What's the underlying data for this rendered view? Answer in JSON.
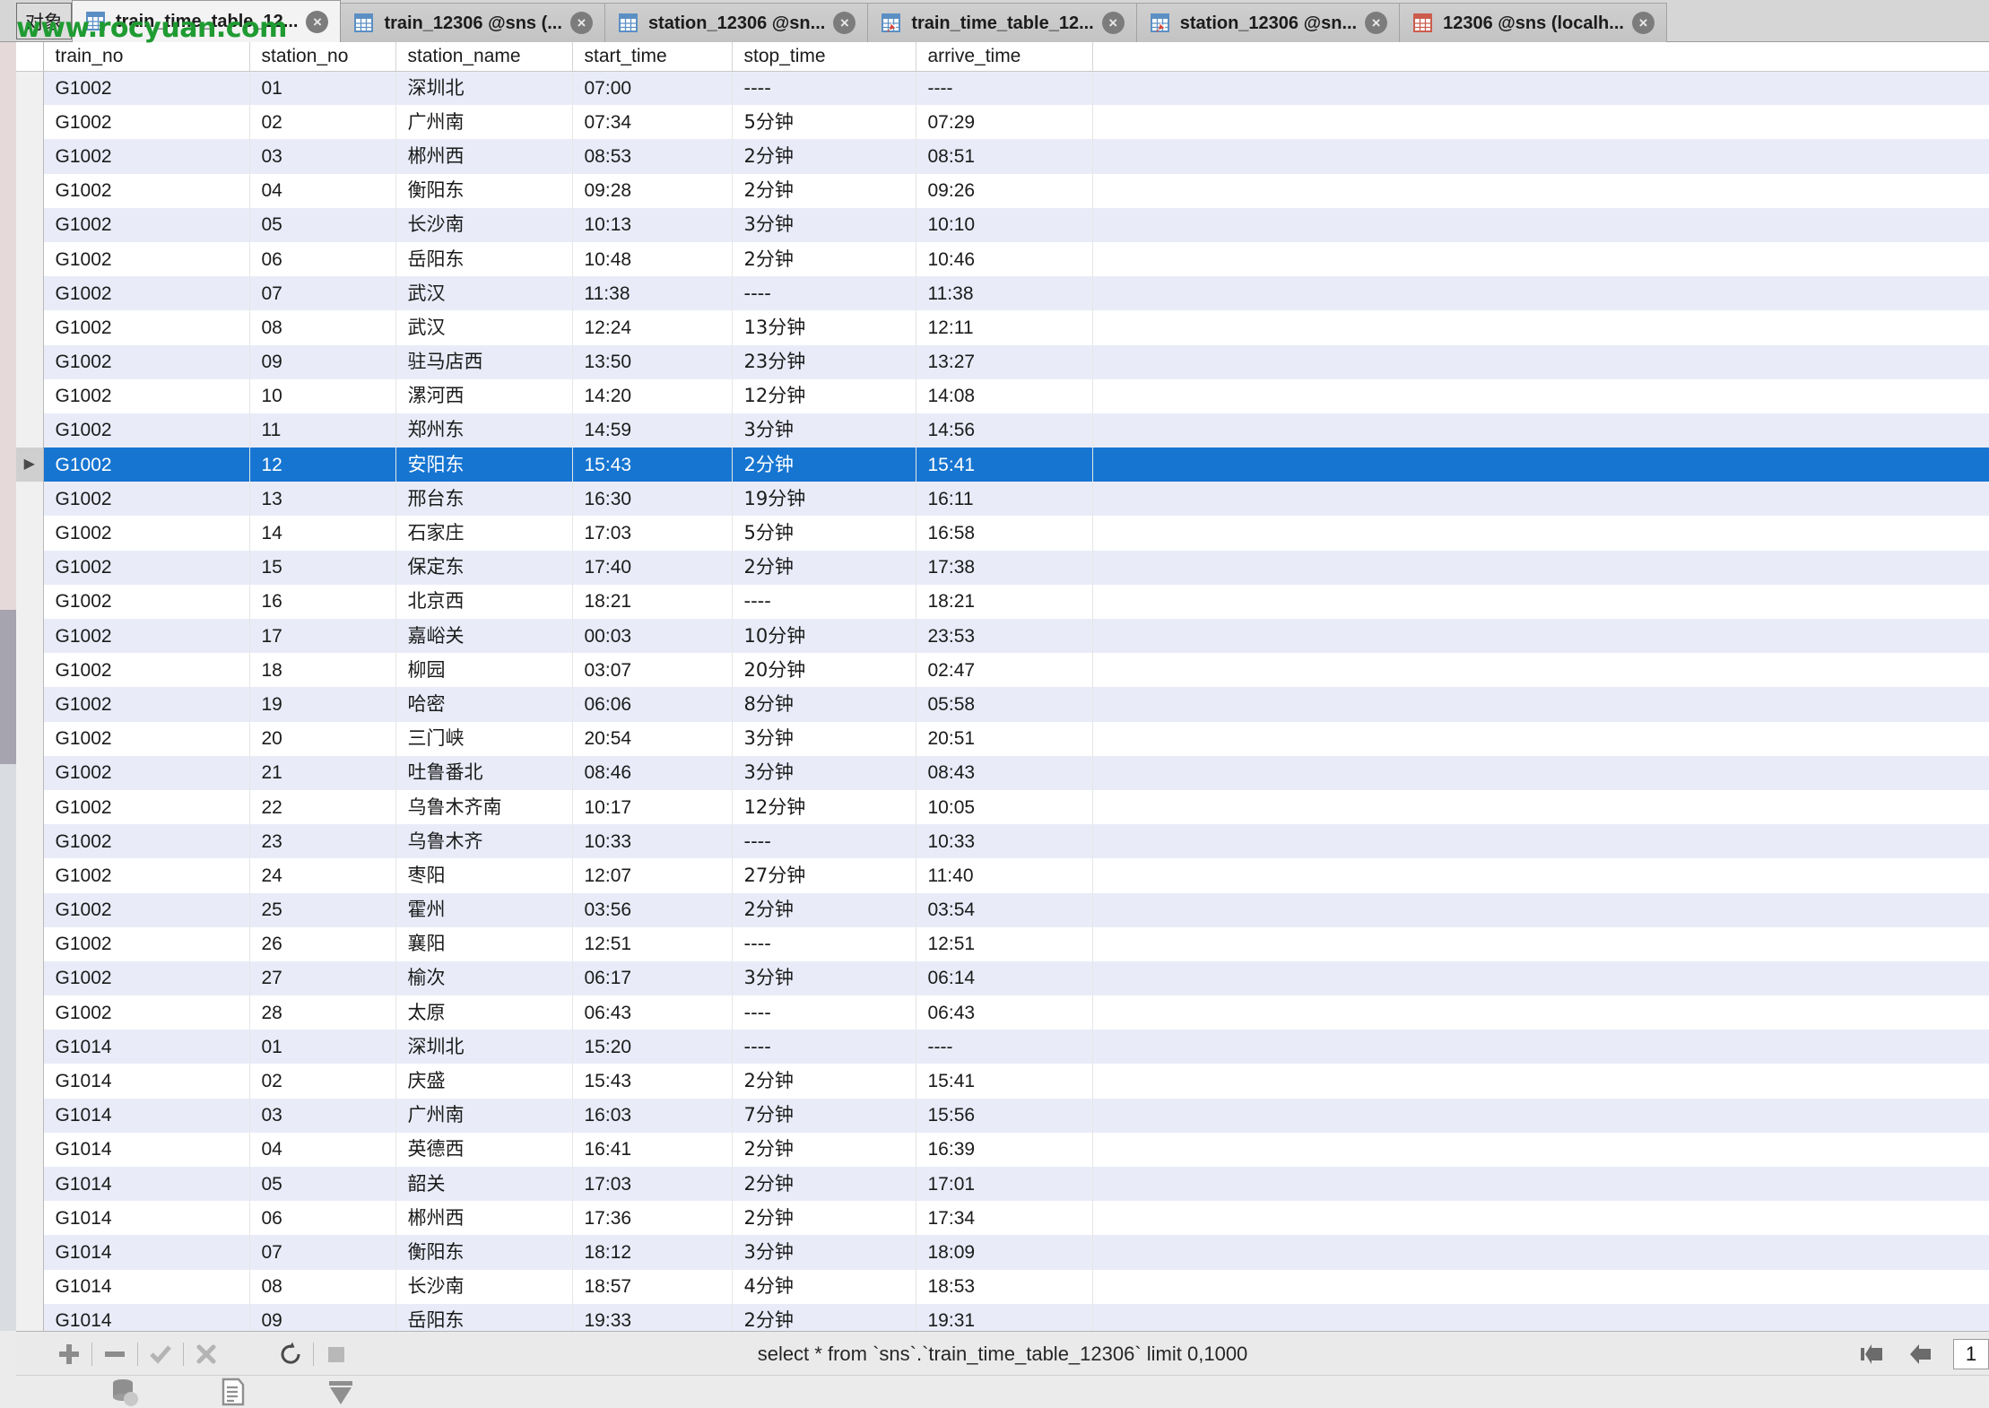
{
  "window": {
    "object_button_label": "对象",
    "watermark": "www.rocyuan.com",
    "accent_selection_color": "#1675d1",
    "alt_row_color": "#e9ecf8",
    "watermark_color": "#1f9b32"
  },
  "tabs": [
    {
      "label": "train_time_table_12...",
      "icon": "table-icon",
      "active": true,
      "close_icon": "close-icon"
    },
    {
      "label": "train_12306 @sns (...",
      "icon": "table-icon",
      "active": false,
      "close_icon": "close-icon"
    },
    {
      "label": "station_12306 @sn...",
      "icon": "table-icon",
      "active": false,
      "close_icon": "close-icon"
    },
    {
      "label": "train_time_table_12...",
      "icon": "table-edit-icon",
      "active": false,
      "close_icon": "close-icon"
    },
    {
      "label": "station_12306 @sn...",
      "icon": "table-edit-icon",
      "active": false,
      "close_icon": "close-icon"
    },
    {
      "label": "12306 @sns (localh...",
      "icon": "database-table-icon",
      "active": false,
      "close_icon": "close-icon"
    }
  ],
  "grid": {
    "columns": [
      "train_no",
      "station_no",
      "station_name",
      "start_time",
      "stop_time",
      "arrive_time"
    ],
    "selected_row_index": 11,
    "rows": [
      [
        "G1002",
        "01",
        "深圳北",
        "07:00",
        "----",
        "----"
      ],
      [
        "G1002",
        "02",
        "广州南",
        "07:34",
        "5分钟",
        "07:29"
      ],
      [
        "G1002",
        "03",
        "郴州西",
        "08:53",
        "2分钟",
        "08:51"
      ],
      [
        "G1002",
        "04",
        "衡阳东",
        "09:28",
        "2分钟",
        "09:26"
      ],
      [
        "G1002",
        "05",
        "长沙南",
        "10:13",
        "3分钟",
        "10:10"
      ],
      [
        "G1002",
        "06",
        "岳阳东",
        "10:48",
        "2分钟",
        "10:46"
      ],
      [
        "G1002",
        "07",
        "武汉",
        "11:38",
        "----",
        "11:38"
      ],
      [
        "G1002",
        "08",
        "武汉",
        "12:24",
        "13分钟",
        "12:11"
      ],
      [
        "G1002",
        "09",
        "驻马店西",
        "13:50",
        "23分钟",
        "13:27"
      ],
      [
        "G1002",
        "10",
        "漯河西",
        "14:20",
        "12分钟",
        "14:08"
      ],
      [
        "G1002",
        "11",
        "郑州东",
        "14:59",
        "3分钟",
        "14:56"
      ],
      [
        "G1002",
        "12",
        "安阳东",
        "15:43",
        "2分钟",
        "15:41"
      ],
      [
        "G1002",
        "13",
        "邢台东",
        "16:30",
        "19分钟",
        "16:11"
      ],
      [
        "G1002",
        "14",
        "石家庄",
        "17:03",
        "5分钟",
        "16:58"
      ],
      [
        "G1002",
        "15",
        "保定东",
        "17:40",
        "2分钟",
        "17:38"
      ],
      [
        "G1002",
        "16",
        "北京西",
        "18:21",
        "----",
        "18:21"
      ],
      [
        "G1002",
        "17",
        "嘉峪关",
        "00:03",
        "10分钟",
        "23:53"
      ],
      [
        "G1002",
        "18",
        "柳园",
        "03:07",
        "20分钟",
        "02:47"
      ],
      [
        "G1002",
        "19",
        "哈密",
        "06:06",
        "8分钟",
        "05:58"
      ],
      [
        "G1002",
        "20",
        "三门峡",
        "20:54",
        "3分钟",
        "20:51"
      ],
      [
        "G1002",
        "21",
        "吐鲁番北",
        "08:46",
        "3分钟",
        "08:43"
      ],
      [
        "G1002",
        "22",
        "乌鲁木齐南",
        "10:17",
        "12分钟",
        "10:05"
      ],
      [
        "G1002",
        "23",
        "乌鲁木齐",
        "10:33",
        "----",
        "10:33"
      ],
      [
        "G1002",
        "24",
        "枣阳",
        "12:07",
        "27分钟",
        "11:40"
      ],
      [
        "G1002",
        "25",
        "霍州",
        "03:56",
        "2分钟",
        "03:54"
      ],
      [
        "G1002",
        "26",
        "襄阳",
        "12:51",
        "----",
        "12:51"
      ],
      [
        "G1002",
        "27",
        "榆次",
        "06:17",
        "3分钟",
        "06:14"
      ],
      [
        "G1002",
        "28",
        "太原",
        "06:43",
        "----",
        "06:43"
      ],
      [
        "G1014",
        "01",
        "深圳北",
        "15:20",
        "----",
        "----"
      ],
      [
        "G1014",
        "02",
        "庆盛",
        "15:43",
        "2分钟",
        "15:41"
      ],
      [
        "G1014",
        "03",
        "广州南",
        "16:03",
        "7分钟",
        "15:56"
      ],
      [
        "G1014",
        "04",
        "英德西",
        "16:41",
        "2分钟",
        "16:39"
      ],
      [
        "G1014",
        "05",
        "韶关",
        "17:03",
        "2分钟",
        "17:01"
      ],
      [
        "G1014",
        "06",
        "郴州西",
        "17:36",
        "2分钟",
        "17:34"
      ],
      [
        "G1014",
        "07",
        "衡阳东",
        "18:12",
        "3分钟",
        "18:09"
      ],
      [
        "G1014",
        "08",
        "长沙南",
        "18:57",
        "4分钟",
        "18:53"
      ],
      [
        "G1014",
        "09",
        "岳阳东",
        "19:33",
        "2分钟",
        "19:31"
      ]
    ]
  },
  "statusbar": {
    "sql": "select * from `sns`.`train_time_table_12306`  limit 0,1000",
    "page_value": "1",
    "buttons": [
      {
        "name": "add-record-button",
        "icon": "plus-icon"
      },
      {
        "name": "delete-record-button",
        "icon": "minus-icon"
      },
      {
        "name": "apply-changes-button",
        "icon": "check-icon"
      },
      {
        "name": "cancel-changes-button",
        "icon": "cross-icon"
      },
      {
        "name": "refresh-button",
        "icon": "refresh-icon"
      },
      {
        "name": "stop-button",
        "icon": "stop-icon"
      }
    ],
    "nav": [
      {
        "name": "first-page-button",
        "icon": "first-page-icon"
      },
      {
        "name": "previous-page-button",
        "icon": "previous-page-icon"
      }
    ]
  },
  "bottombar": {
    "buttons": [
      {
        "name": "data-view-button",
        "icon": "database-icon"
      },
      {
        "name": "form-view-button",
        "icon": "document-icon"
      },
      {
        "name": "filter-button",
        "icon": "filter-icon"
      }
    ]
  }
}
